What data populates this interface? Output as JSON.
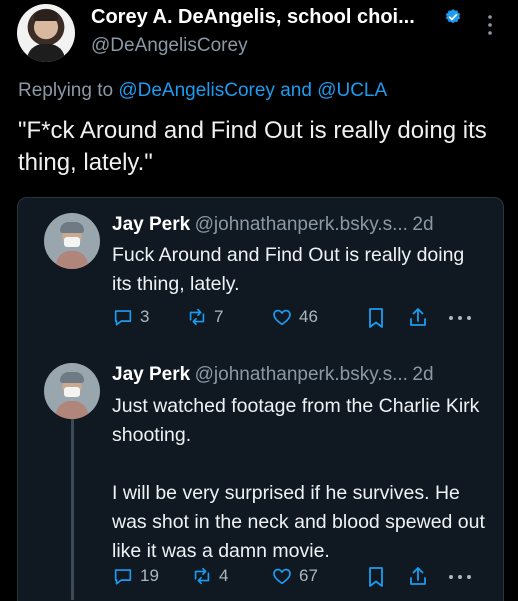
{
  "author": {
    "name": "Corey A. DeAngelis, school choi...",
    "handle": "@DeAngelisCorey"
  },
  "replying": {
    "prefix": "Replying to",
    "mention1": "@DeAngelisCorey",
    "conj": "and",
    "mention2": "@UCLA"
  },
  "quote_text": "\"F*ck Around and Find Out is really doing its thing, lately.\"",
  "replies": [
    {
      "name": "Jay Perk",
      "handle": "@johnathanperk.bsky.s...",
      "time": "2d",
      "text": "Fuck Around and Find Out is really doing its thing, lately.",
      "replies": "3",
      "reposts": "7",
      "likes": "46"
    },
    {
      "name": "Jay Perk",
      "handle": "@johnathanperk.bsky.s...",
      "time": "2d",
      "text": "Just watched footage from the Charlie Kirk shooting.\n\nI will be very surprised if he survives. He was shot in the neck and blood spewed out like it was a damn movie.",
      "replies": "19",
      "reposts": "4",
      "likes": "67"
    }
  ],
  "icons": {
    "verified": "verified-badge-icon",
    "more": "more-vertical-icon",
    "reply": "reply-bubble-icon",
    "repost": "repost-icon",
    "like": "heart-icon",
    "bookmark": "bookmark-icon",
    "share": "share-icon",
    "ellipsis": "ellipsis-icon"
  },
  "colors": {
    "background": "#000000",
    "card": "#101922",
    "link": "#1d9bf0",
    "muted": "#8b98a5",
    "verified": "#1d9bf0"
  }
}
